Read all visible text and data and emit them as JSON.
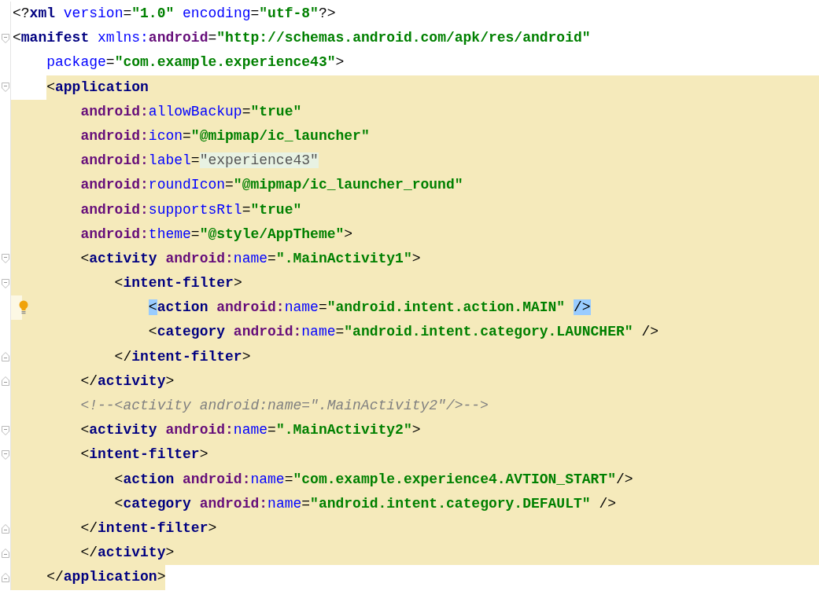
{
  "editor": {
    "lines": [
      {
        "kind": "plain",
        "fold_start": false,
        "fold_end": false,
        "caret": false,
        "tokens": [
          {
            "kind": "punct",
            "text": "<?"
          },
          {
            "kind": "tag",
            "text": "xml"
          },
          {
            "kind": "attr",
            "text": " version"
          },
          {
            "kind": "punct",
            "text": "="
          },
          {
            "kind": "value",
            "text": "\"1.0\""
          },
          {
            "kind": "attr",
            "text": " encoding"
          },
          {
            "kind": "punct",
            "text": "="
          },
          {
            "kind": "value",
            "text": "\"utf-8\""
          },
          {
            "kind": "punct",
            "text": "?>"
          }
        ]
      },
      {
        "kind": "plain",
        "fold_start": true,
        "fold_end": false,
        "caret": false,
        "tokens": [
          {
            "kind": "punct",
            "text": "<"
          },
          {
            "kind": "tag",
            "text": "manifest"
          },
          {
            "kind": "attr",
            "text": " xmlns:"
          },
          {
            "kind": "ns",
            "text": "android"
          },
          {
            "kind": "punct",
            "text": "="
          },
          {
            "kind": "value",
            "text": "\"http://schemas.android.com/apk/res/android\""
          }
        ]
      },
      {
        "kind": "plain",
        "fold_start": false,
        "fold_end": false,
        "caret": false,
        "tokens": [
          {
            "kind": "attr",
            "text": "    package"
          },
          {
            "kind": "punct",
            "text": "="
          },
          {
            "kind": "value",
            "text": "\"com.example.experience43\""
          },
          {
            "kind": "punct",
            "text": ">"
          }
        ]
      },
      {
        "kind": "opener",
        "fold_start": true,
        "fold_end": false,
        "caret": false,
        "tokens": [
          {
            "kind": "punct",
            "text": "    <"
          },
          {
            "kind": "tag",
            "text": "application"
          }
        ]
      },
      {
        "kind": "scoped",
        "fold_start": false,
        "fold_end": false,
        "caret": false,
        "tokens": [
          {
            "kind": "ns",
            "text": "        android:"
          },
          {
            "kind": "attr",
            "text": "allowBackup"
          },
          {
            "kind": "punct",
            "text": "="
          },
          {
            "kind": "value",
            "text": "\"true\""
          }
        ]
      },
      {
        "kind": "scoped",
        "fold_start": false,
        "fold_end": false,
        "caret": false,
        "tokens": [
          {
            "kind": "ns",
            "text": "        android:"
          },
          {
            "kind": "attr",
            "text": "icon"
          },
          {
            "kind": "punct",
            "text": "="
          },
          {
            "kind": "value",
            "text": "\"@mipmap/ic_launcher\""
          }
        ]
      },
      {
        "kind": "scoped",
        "fold_start": false,
        "fold_end": false,
        "caret": false,
        "tokens": [
          {
            "kind": "ns",
            "text": "        android:"
          },
          {
            "kind": "attr",
            "text": "label"
          },
          {
            "kind": "punct",
            "text": "="
          },
          {
            "kind": "folded",
            "text": "\"experience43\""
          }
        ]
      },
      {
        "kind": "scoped",
        "fold_start": false,
        "fold_end": false,
        "caret": false,
        "tokens": [
          {
            "kind": "ns",
            "text": "        android:"
          },
          {
            "kind": "attr",
            "text": "roundIcon"
          },
          {
            "kind": "punct",
            "text": "="
          },
          {
            "kind": "value",
            "text": "\"@mipmap/ic_launcher_round\""
          }
        ]
      },
      {
        "kind": "scoped",
        "fold_start": false,
        "fold_end": false,
        "caret": false,
        "tokens": [
          {
            "kind": "ns",
            "text": "        android:"
          },
          {
            "kind": "attr",
            "text": "supportsRtl"
          },
          {
            "kind": "punct",
            "text": "="
          },
          {
            "kind": "value",
            "text": "\"true\""
          }
        ]
      },
      {
        "kind": "scoped",
        "fold_start": false,
        "fold_end": false,
        "caret": false,
        "tokens": [
          {
            "kind": "ns",
            "text": "        android:"
          },
          {
            "kind": "attr",
            "text": "theme"
          },
          {
            "kind": "punct",
            "text": "="
          },
          {
            "kind": "value",
            "text": "\"@style/AppTheme\""
          },
          {
            "kind": "punct",
            "text": ">"
          }
        ]
      },
      {
        "kind": "scoped",
        "fold_start": true,
        "fold_end": false,
        "caret": false,
        "tokens": [
          {
            "kind": "punct",
            "text": "        <"
          },
          {
            "kind": "tag",
            "text": "activity"
          },
          {
            "kind": "ns",
            "text": " android:"
          },
          {
            "kind": "attr",
            "text": "name"
          },
          {
            "kind": "punct",
            "text": "="
          },
          {
            "kind": "value",
            "text": "\".MainActivity1\""
          },
          {
            "kind": "punct",
            "text": ">"
          }
        ]
      },
      {
        "kind": "scoped",
        "fold_start": true,
        "fold_end": false,
        "caret": false,
        "tokens": [
          {
            "kind": "punct",
            "text": "            <"
          },
          {
            "kind": "tag",
            "text": "intent-filter"
          },
          {
            "kind": "punct",
            "text": ">"
          }
        ]
      },
      {
        "kind": "scoped",
        "fold_start": false,
        "fold_end": false,
        "caret": true,
        "tokens": [
          {
            "kind": "match",
            "text": "                <"
          },
          {
            "kind": "tag",
            "text": "action"
          },
          {
            "kind": "ns",
            "text": " android:"
          },
          {
            "kind": "attr",
            "text": "name"
          },
          {
            "kind": "punct",
            "text": "="
          },
          {
            "kind": "value",
            "text": "\"android.intent.action.MAIN\" "
          },
          {
            "kind": "match",
            "text": "/>"
          }
        ]
      },
      {
        "kind": "scoped",
        "fold_start": false,
        "fold_end": false,
        "caret": false,
        "tokens": [
          {
            "kind": "punct",
            "text": "                <"
          },
          {
            "kind": "tag",
            "text": "category"
          },
          {
            "kind": "ns",
            "text": " android:"
          },
          {
            "kind": "attr",
            "text": "name"
          },
          {
            "kind": "punct",
            "text": "="
          },
          {
            "kind": "value",
            "text": "\"android.intent.category.LAUNCHER\""
          },
          {
            "kind": "punct",
            "text": " />"
          }
        ]
      },
      {
        "kind": "scoped",
        "fold_start": false,
        "fold_end": true,
        "caret": false,
        "tokens": [
          {
            "kind": "punct",
            "text": "            </"
          },
          {
            "kind": "tag",
            "text": "intent-filter"
          },
          {
            "kind": "punct",
            "text": ">"
          }
        ]
      },
      {
        "kind": "scoped",
        "fold_start": false,
        "fold_end": true,
        "caret": false,
        "tokens": [
          {
            "kind": "punct",
            "text": "        </"
          },
          {
            "kind": "tag",
            "text": "activity"
          },
          {
            "kind": "punct",
            "text": ">"
          }
        ]
      },
      {
        "kind": "scoped",
        "fold_start": false,
        "fold_end": false,
        "caret": false,
        "tokens": [
          {
            "kind": "comment",
            "text": "        <!--<activity android:name=\".MainActivity2\"/>-->"
          }
        ]
      },
      {
        "kind": "scoped",
        "fold_start": true,
        "fold_end": false,
        "caret": false,
        "tokens": [
          {
            "kind": "punct",
            "text": "        <"
          },
          {
            "kind": "tag",
            "text": "activity"
          },
          {
            "kind": "ns",
            "text": " android:"
          },
          {
            "kind": "attr",
            "text": "name"
          },
          {
            "kind": "punct",
            "text": "="
          },
          {
            "kind": "value",
            "text": "\".MainActivity2\""
          },
          {
            "kind": "punct",
            "text": ">"
          }
        ]
      },
      {
        "kind": "scoped",
        "fold_start": true,
        "fold_end": false,
        "caret": false,
        "tokens": [
          {
            "kind": "punct",
            "text": "        <"
          },
          {
            "kind": "tag",
            "text": "intent-filter"
          },
          {
            "kind": "punct",
            "text": ">"
          }
        ]
      },
      {
        "kind": "scoped",
        "fold_start": false,
        "fold_end": false,
        "caret": false,
        "tokens": [
          {
            "kind": "punct",
            "text": "            <"
          },
          {
            "kind": "tag",
            "text": "action"
          },
          {
            "kind": "ns",
            "text": " android:"
          },
          {
            "kind": "attr",
            "text": "name"
          },
          {
            "kind": "punct",
            "text": "="
          },
          {
            "kind": "value",
            "text": "\"com.example.experience4.AVTION_START\""
          },
          {
            "kind": "punct",
            "text": "/>"
          }
        ]
      },
      {
        "kind": "scoped",
        "fold_start": false,
        "fold_end": false,
        "caret": false,
        "tokens": [
          {
            "kind": "punct",
            "text": "            <"
          },
          {
            "kind": "tag",
            "text": "category"
          },
          {
            "kind": "ns",
            "text": " android:"
          },
          {
            "kind": "attr",
            "text": "name"
          },
          {
            "kind": "punct",
            "text": "="
          },
          {
            "kind": "value",
            "text": "\"android.intent.category.DEFAULT\""
          },
          {
            "kind": "punct",
            "text": " />"
          }
        ]
      },
      {
        "kind": "scoped",
        "fold_start": false,
        "fold_end": true,
        "caret": false,
        "tokens": [
          {
            "kind": "punct",
            "text": "        </"
          },
          {
            "kind": "tag",
            "text": "intent-filter"
          },
          {
            "kind": "punct",
            "text": ">"
          }
        ]
      },
      {
        "kind": "scoped",
        "fold_start": false,
        "fold_end": true,
        "caret": false,
        "tokens": [
          {
            "kind": "punct",
            "text": "        </"
          },
          {
            "kind": "tag",
            "text": "activity"
          },
          {
            "kind": "punct",
            "text": ">"
          }
        ]
      },
      {
        "kind": "closer",
        "fold_start": false,
        "fold_end": true,
        "caret": false,
        "tokens": [
          {
            "kind": "punct",
            "text": "    </"
          },
          {
            "kind": "tag",
            "text": "application"
          },
          {
            "kind": "punct",
            "text": ">"
          }
        ]
      }
    ]
  }
}
